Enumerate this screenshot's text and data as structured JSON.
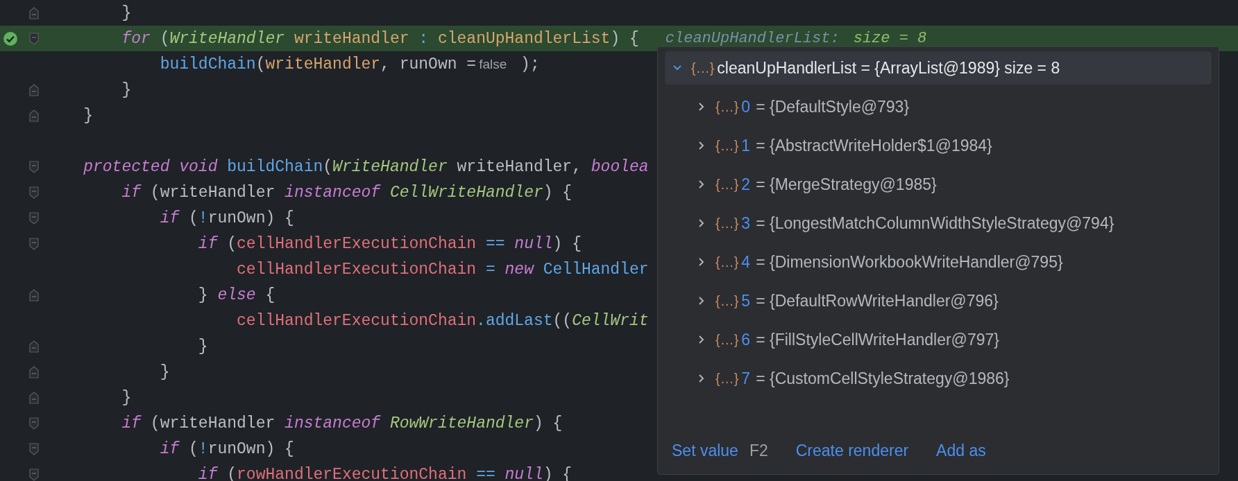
{
  "editor": {
    "lines": [
      {
        "fold_start": false,
        "fold_end": true,
        "breakpoint": false,
        "current": false,
        "tokens": [
          {
            "text": "        }",
            "kind": "plain"
          }
        ]
      },
      {
        "fold_start": true,
        "fold_end": false,
        "breakpoint": true,
        "current": true,
        "tokens": [
          {
            "text": "        for",
            "kind": "keyword"
          },
          {
            "text": " (",
            "kind": "plain"
          },
          {
            "text": "WriteHandler",
            "kind": "type"
          },
          {
            "text": " writeHandler ",
            "kind": "var"
          },
          {
            "text": ":",
            "kind": "op"
          },
          {
            "text": " cleanUpHandlerList",
            "kind": "var"
          },
          {
            "text": ") {",
            "kind": "plain"
          }
        ],
        "inline_value": {
          "name": "cleanUpHandlerList:",
          "value": "size = 8"
        }
      },
      {
        "fold_start": false,
        "fold_end": false,
        "breakpoint": false,
        "current": false,
        "tokens": [
          {
            "text": "            buildChain",
            "kind": "fn"
          },
          {
            "text": "(",
            "kind": "plain"
          },
          {
            "text": "writeHandler",
            "kind": "var"
          },
          {
            "text": ", runOwn =",
            "kind": "plain"
          },
          {
            "text": "false",
            "kind": "hint"
          },
          {
            "text": " );",
            "kind": "plain"
          }
        ]
      },
      {
        "fold_start": false,
        "fold_end": true,
        "breakpoint": false,
        "current": false,
        "tokens": [
          {
            "text": "        }",
            "kind": "plain"
          }
        ]
      },
      {
        "fold_start": false,
        "fold_end": true,
        "breakpoint": false,
        "current": false,
        "tokens": [
          {
            "text": "    }",
            "kind": "plain"
          }
        ]
      },
      {
        "fold_start": false,
        "fold_end": false,
        "breakpoint": false,
        "current": false
      },
      {
        "fold_start": true,
        "fold_end": false,
        "breakpoint": false,
        "current": false,
        "tokens": [
          {
            "text": "    protected void",
            "kind": "keyword"
          },
          {
            "text": " buildChain",
            "kind": "fn"
          },
          {
            "text": "(",
            "kind": "plain"
          },
          {
            "text": "WriteHandler",
            "kind": "type"
          },
          {
            "text": " writeHandler, ",
            "kind": "plain"
          },
          {
            "text": "boolea",
            "kind": "keyword"
          }
        ]
      },
      {
        "fold_start": true,
        "fold_end": false,
        "breakpoint": false,
        "current": false,
        "tokens": [
          {
            "text": "        if",
            "kind": "keyword"
          },
          {
            "text": " (writeHandler ",
            "kind": "plain"
          },
          {
            "text": "instanceof",
            "kind": "keyword"
          },
          {
            "text": " CellWriteHandler",
            "kind": "type"
          },
          {
            "text": ") {",
            "kind": "plain"
          }
        ]
      },
      {
        "fold_start": true,
        "fold_end": false,
        "breakpoint": false,
        "current": false,
        "tokens": [
          {
            "text": "            if",
            "kind": "keyword"
          },
          {
            "text": " (",
            "kind": "plain"
          },
          {
            "text": "!",
            "kind": "op"
          },
          {
            "text": "runOwn) {",
            "kind": "plain"
          }
        ]
      },
      {
        "fold_start": true,
        "fold_end": false,
        "breakpoint": false,
        "current": false,
        "tokens": [
          {
            "text": "                if",
            "kind": "keyword"
          },
          {
            "text": " (",
            "kind": "plain"
          },
          {
            "text": "cellHandlerExecutionChain",
            "kind": "field"
          },
          {
            "text": " ==",
            "kind": "op"
          },
          {
            "text": " null",
            "kind": "keyword"
          },
          {
            "text": ") {",
            "kind": "plain"
          }
        ]
      },
      {
        "fold_start": false,
        "fold_end": false,
        "breakpoint": false,
        "current": false,
        "tokens": [
          {
            "text": "                    cellHandlerExecutionChain",
            "kind": "field"
          },
          {
            "text": " =",
            "kind": "op"
          },
          {
            "text": " new",
            "kind": "keyword"
          },
          {
            "text": " CellHandler",
            "kind": "fn"
          }
        ]
      },
      {
        "fold_start": false,
        "fold_end": true,
        "breakpoint": false,
        "current": false,
        "tokens": [
          {
            "text": "                } ",
            "kind": "plain"
          },
          {
            "text": "else",
            "kind": "keyword"
          },
          {
            "text": " {",
            "kind": "plain"
          }
        ]
      },
      {
        "fold_start": false,
        "fold_end": false,
        "breakpoint": false,
        "current": false,
        "tokens": [
          {
            "text": "                    cellHandlerExecutionChain",
            "kind": "field"
          },
          {
            "text": ".addLast",
            "kind": "fn"
          },
          {
            "text": "((",
            "kind": "plain"
          },
          {
            "text": "CellWrit",
            "kind": "type"
          }
        ]
      },
      {
        "fold_start": false,
        "fold_end": true,
        "breakpoint": false,
        "current": false,
        "tokens": [
          {
            "text": "                }",
            "kind": "plain"
          }
        ]
      },
      {
        "fold_start": false,
        "fold_end": true,
        "breakpoint": false,
        "current": false,
        "tokens": [
          {
            "text": "            }",
            "kind": "plain"
          }
        ]
      },
      {
        "fold_start": false,
        "fold_end": true,
        "breakpoint": false,
        "current": false,
        "tokens": [
          {
            "text": "        }",
            "kind": "plain"
          }
        ]
      },
      {
        "fold_start": true,
        "fold_end": false,
        "breakpoint": false,
        "current": false,
        "tokens": [
          {
            "text": "        if",
            "kind": "keyword"
          },
          {
            "text": " (writeHandler ",
            "kind": "plain"
          },
          {
            "text": "instanceof",
            "kind": "keyword"
          },
          {
            "text": " RowWriteHandler",
            "kind": "type"
          },
          {
            "text": ") {",
            "kind": "plain"
          }
        ]
      },
      {
        "fold_start": true,
        "fold_end": false,
        "breakpoint": false,
        "current": false,
        "tokens": [
          {
            "text": "            if",
            "kind": "keyword"
          },
          {
            "text": " (",
            "kind": "plain"
          },
          {
            "text": "!",
            "kind": "op"
          },
          {
            "text": "runOwn) {",
            "kind": "plain"
          }
        ]
      },
      {
        "fold_start": true,
        "fold_end": false,
        "breakpoint": false,
        "current": false,
        "tokens": [
          {
            "text": "                if",
            "kind": "keyword"
          },
          {
            "text": " (",
            "kind": "plain"
          },
          {
            "text": "rowHandlerExecutionChain",
            "kind": "field"
          },
          {
            "text": " ==",
            "kind": "op"
          },
          {
            "text": " null",
            "kind": "keyword"
          },
          {
            "text": ") {",
            "kind": "plain"
          }
        ]
      }
    ]
  },
  "value_popup": {
    "root": {
      "icon": "{…}",
      "label": "cleanUpHandlerList = {ArrayList@1989}  size = 8",
      "expanded": true,
      "selected": true
    },
    "items": [
      {
        "icon": "{…}",
        "index": "0",
        "value": "= {DefaultStyle@793}",
        "expanded": false
      },
      {
        "icon": "{…}",
        "index": "1",
        "value": "= {AbstractWriteHolder$1@1984}",
        "expanded": false
      },
      {
        "icon": "{…}",
        "index": "2",
        "value": "= {MergeStrategy@1985}",
        "expanded": false
      },
      {
        "icon": "{…}",
        "index": "3",
        "value": "= {LongestMatchColumnWidthStyleStrategy@794}",
        "expanded": false
      },
      {
        "icon": "{…}",
        "index": "4",
        "value": "= {DimensionWorkbookWriteHandler@795}",
        "expanded": false
      },
      {
        "icon": "{…}",
        "index": "5",
        "value": "= {DefaultRowWriteHandler@796}",
        "expanded": false
      },
      {
        "icon": "{…}",
        "index": "6",
        "value": "= {FillStyleCellWriteHandler@797}",
        "expanded": false
      },
      {
        "icon": "{…}",
        "index": "7",
        "value": "= {CustomCellStyleStrategy@1986}",
        "expanded": false
      }
    ],
    "actions": [
      {
        "label": "Set value",
        "shortcut": "F2"
      },
      {
        "label": "Create renderer"
      },
      {
        "label": "Add as"
      }
    ]
  }
}
